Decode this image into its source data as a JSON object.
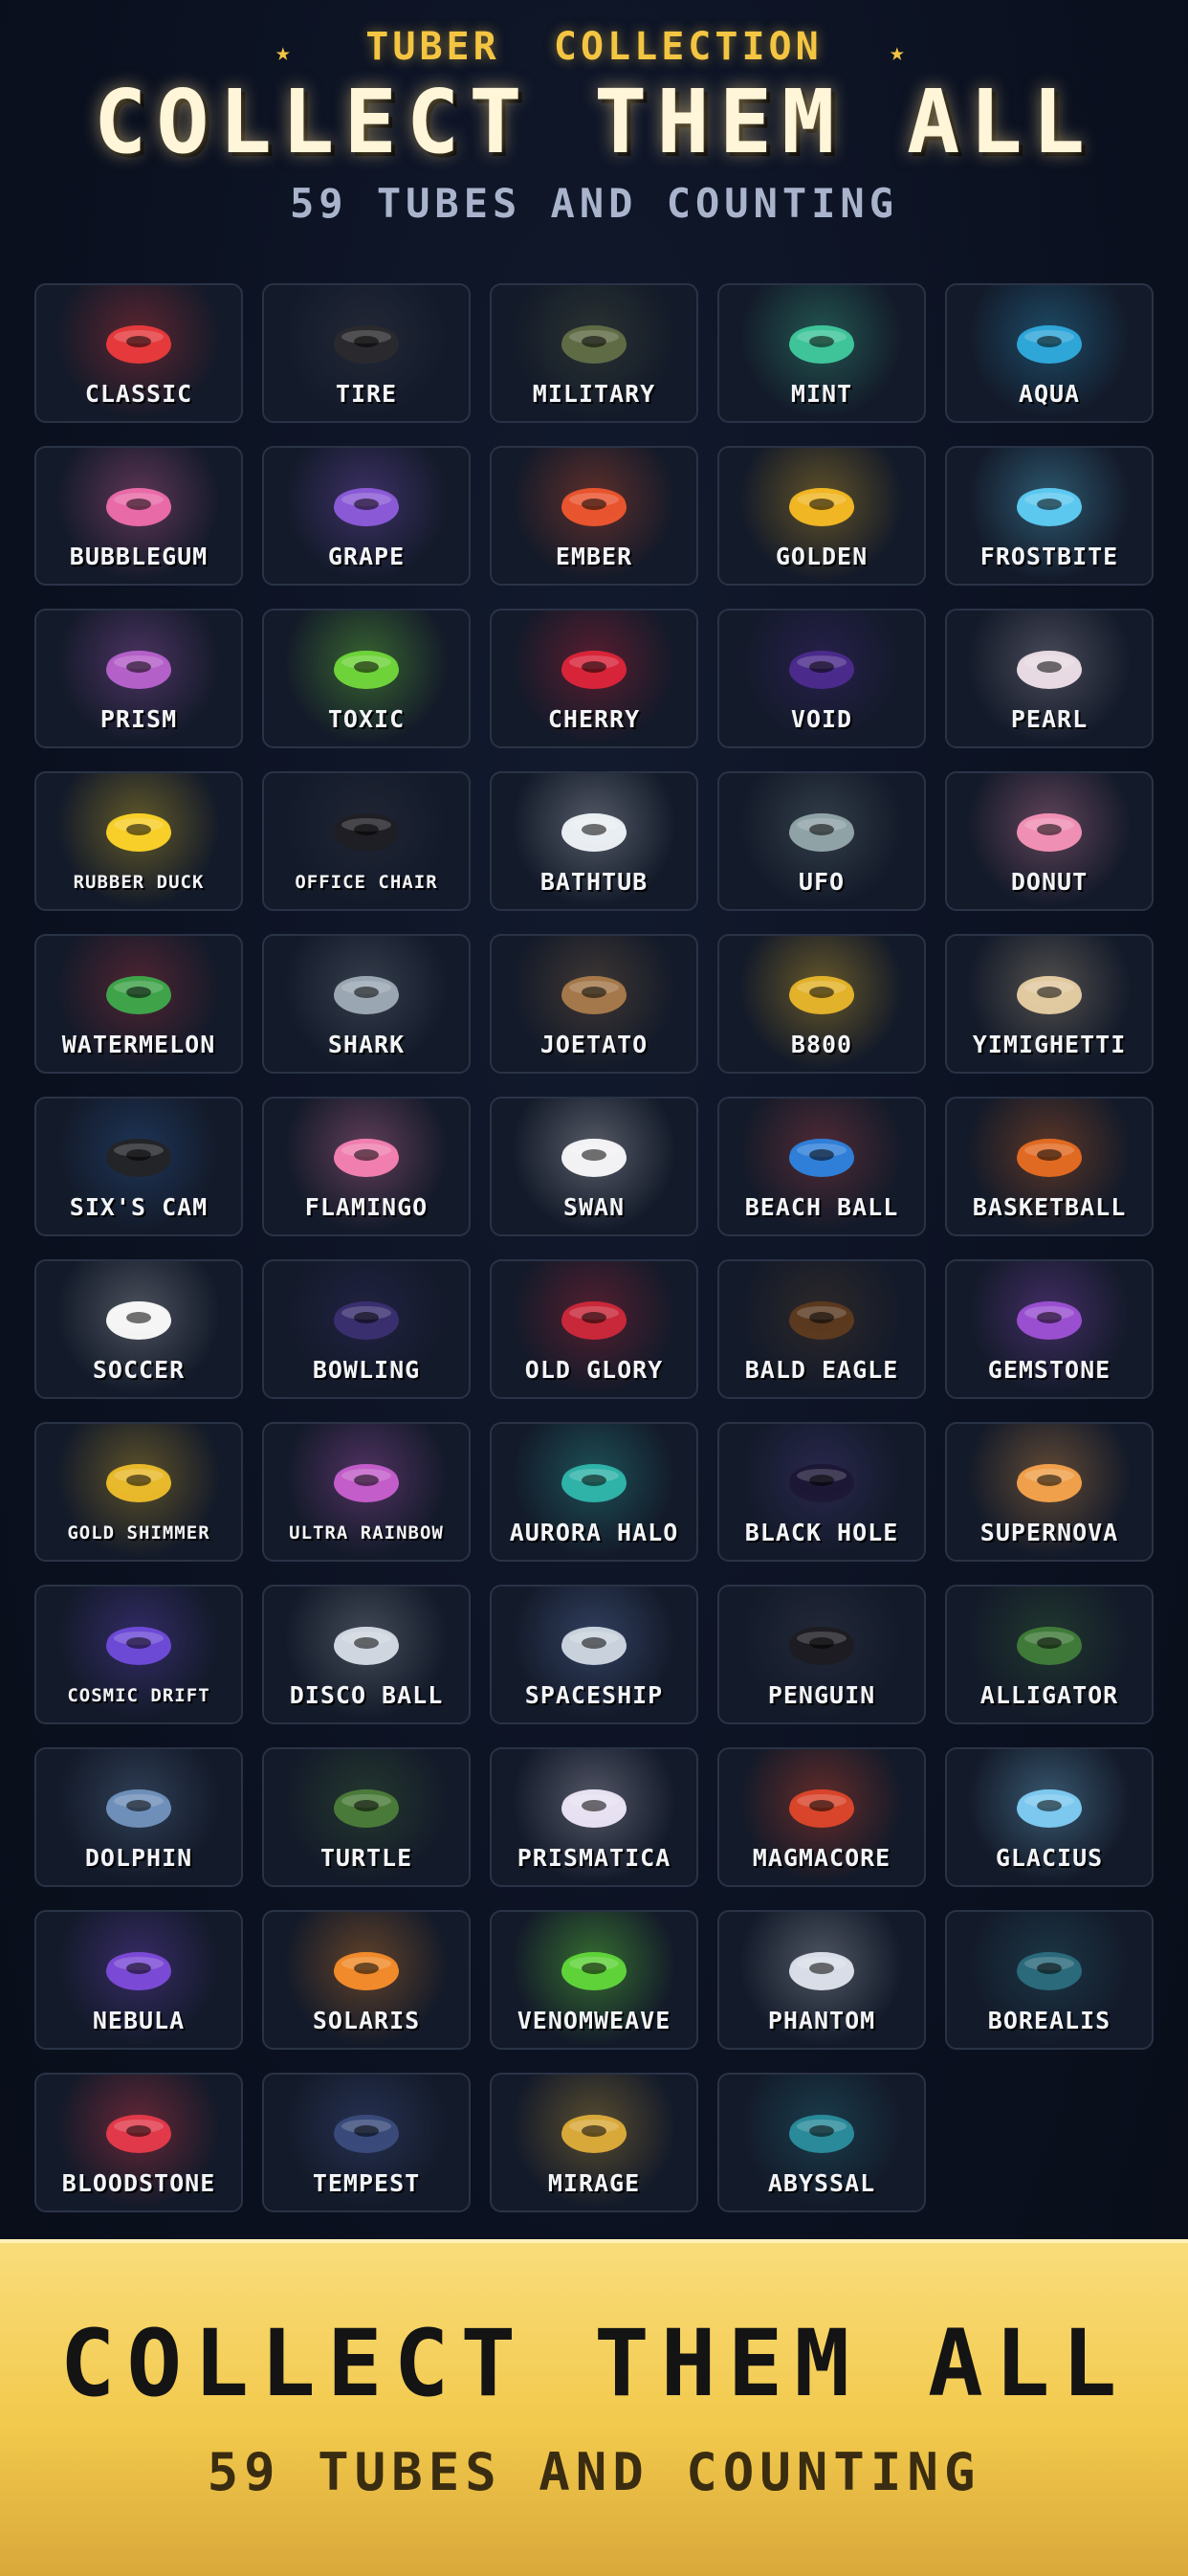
{
  "header": {
    "eyebrow": "TUBER  COLLECTION",
    "title": "COLLECT THEM ALL",
    "subtitle": "59 TUBES AND COUNTING"
  },
  "tubes": [
    {
      "name": "CLASSIC",
      "color": "#e5393c",
      "glow": "rgba(229,57,60,0.35)",
      "icon": "ring-icon"
    },
    {
      "name": "TIRE",
      "color": "#2a2a2e",
      "glow": "rgba(120,120,130,0.15)",
      "icon": "ring-icon"
    },
    {
      "name": "MILITARY",
      "color": "#5f6b45",
      "glow": "rgba(95,107,69,0.3)",
      "icon": "ring-icon"
    },
    {
      "name": "MINT",
      "color": "#3fc49a",
      "glow": "rgba(63,196,154,0.35)",
      "icon": "ring-icon"
    },
    {
      "name": "AQUA",
      "color": "#2fa6d8",
      "glow": "rgba(47,166,216,0.35)",
      "icon": "ring-icon"
    },
    {
      "name": "BUBBLEGUM",
      "color": "#e86aa7",
      "glow": "rgba(232,106,167,0.35)",
      "icon": "ring-icon"
    },
    {
      "name": "GRAPE",
      "color": "#8a5ad6",
      "glow": "rgba(138,90,214,0.35)",
      "icon": "ring-icon"
    },
    {
      "name": "EMBER",
      "color": "#e8552e",
      "glow": "rgba(232,85,46,0.35)",
      "icon": "ring-icon"
    },
    {
      "name": "GOLDEN",
      "color": "#f0b623",
      "glow": "rgba(240,182,35,0.35)",
      "icon": "ring-icon"
    },
    {
      "name": "FROSTBITE",
      "color": "#5cc8ee",
      "glow": "rgba(92,200,238,0.35)",
      "icon": "ring-icon"
    },
    {
      "name": "PRISM",
      "color": "#b460c9",
      "glow": "rgba(180,96,201,0.35)",
      "icon": "ring-icon"
    },
    {
      "name": "TOXIC",
      "color": "#6fd23a",
      "glow": "rgba(111,210,58,0.4)",
      "icon": "ring-icon"
    },
    {
      "name": "CHERRY",
      "color": "#d8243a",
      "glow": "rgba(216,36,58,0.35)",
      "icon": "ring-icon"
    },
    {
      "name": "VOID",
      "color": "#4a2a8a",
      "glow": "rgba(74,42,138,0.35)",
      "icon": "ring-icon"
    },
    {
      "name": "PEARL",
      "color": "#e8d9e2",
      "glow": "rgba(232,217,226,0.25)",
      "icon": "ring-icon"
    },
    {
      "name": "RUBBER DUCK",
      "color": "#f7cf28",
      "glow": "rgba(247,207,40,0.35)",
      "icon": "duck-icon",
      "small": true
    },
    {
      "name": "OFFICE CHAIR",
      "color": "#1e1f24",
      "glow": "rgba(100,100,110,0.15)",
      "icon": "chair-icon",
      "small": true
    },
    {
      "name": "BATHTUB",
      "color": "#e9edf2",
      "glow": "rgba(233,237,242,0.3)",
      "icon": "bathtub-icon"
    },
    {
      "name": "UFO",
      "color": "#8fa2a6",
      "glow": "rgba(143,162,166,0.25)",
      "icon": "ufo-icon"
    },
    {
      "name": "DONUT",
      "color": "#f08fb4",
      "glow": "rgba(240,143,180,0.35)",
      "icon": "donut-icon"
    },
    {
      "name": "WATERMELON",
      "color": "#3fa34a",
      "glow": "rgba(220,60,70,0.3)",
      "icon": "watermelon-icon"
    },
    {
      "name": "SHARK",
      "color": "#9aa7b3",
      "glow": "rgba(154,167,179,0.25)",
      "icon": "shark-icon"
    },
    {
      "name": "JOETATO",
      "color": "#a4784a",
      "glow": "rgba(164,120,74,0.3)",
      "icon": "potato-icon"
    },
    {
      "name": "B800",
      "color": "#e2b22a",
      "glow": "rgba(226,178,42,0.4)",
      "icon": "star-badge-icon"
    },
    {
      "name": "YIMIGHETTI",
      "color": "#e0c9a0",
      "glow": "rgba(224,201,160,0.3)",
      "icon": "noodle-bowl-icon"
    },
    {
      "name": "SIX'S CAM",
      "color": "#222428",
      "glow": "rgba(60,130,220,0.25)",
      "icon": "camera-icon"
    },
    {
      "name": "FLAMINGO",
      "color": "#f07fb0",
      "glow": "rgba(240,127,176,0.35)",
      "icon": "flamingo-icon"
    },
    {
      "name": "SWAN",
      "color": "#f2f2f4",
      "glow": "rgba(242,242,244,0.3)",
      "icon": "swan-icon"
    },
    {
      "name": "BEACH BALL",
      "color": "#2f7fd8",
      "glow": "rgba(220,80,80,0.3)",
      "icon": "beach-ball-icon"
    },
    {
      "name": "BASKETBALL",
      "color": "#e06a22",
      "glow": "rgba(224,106,34,0.35)",
      "icon": "basketball-icon"
    },
    {
      "name": "SOCCER",
      "color": "#f4f4f4",
      "glow": "rgba(244,244,244,0.25)",
      "icon": "soccer-ball-icon"
    },
    {
      "name": "BOWLING",
      "color": "#3a2f6e",
      "glow": "rgba(58,47,110,0.35)",
      "icon": "bowling-ball-icon"
    },
    {
      "name": "OLD GLORY",
      "color": "#c8283a",
      "glow": "rgba(200,40,58,0.35)",
      "icon": "flag-ring-icon"
    },
    {
      "name": "BALD EAGLE",
      "color": "#5b3a20",
      "glow": "rgba(120,80,40,0.25)",
      "icon": "eagle-icon"
    },
    {
      "name": "GEMSTONE",
      "color": "#9a4fd0",
      "glow": "rgba(154,79,208,0.35)",
      "icon": "gem-ring-icon"
    },
    {
      "name": "GOLD SHIMMER",
      "color": "#e8b82a",
      "glow": "rgba(232,184,42,0.35)",
      "icon": "ring-icon",
      "small": true
    },
    {
      "name": "ULTRA RAINBOW",
      "color": "#c25dc9",
      "glow": "rgba(194,93,201,0.35)",
      "icon": "ring-icon",
      "small": true
    },
    {
      "name": "AURORA HALO",
      "color": "#2fb2a8",
      "glow": "rgba(47,178,168,0.35)",
      "icon": "ring-icon"
    },
    {
      "name": "BLACK HOLE",
      "color": "#1d1836",
      "glow": "rgba(90,70,160,0.3)",
      "icon": "ring-icon"
    },
    {
      "name": "SUPERNOVA",
      "color": "#f0a04a",
      "glow": "rgba(240,160,74,0.35)",
      "icon": "ring-icon"
    },
    {
      "name": "COSMIC DRIFT",
      "color": "#6d4ad6",
      "glow": "rgba(109,74,214,0.35)",
      "icon": "ring-icon",
      "small": true
    },
    {
      "name": "DISCO BALL",
      "color": "#cfd6df",
      "glow": "rgba(207,214,223,0.25)",
      "icon": "disco-ball-icon"
    },
    {
      "name": "SPACESHIP",
      "color": "#c9d2dc",
      "glow": "rgba(120,150,220,0.3)",
      "icon": "rocket-icon"
    },
    {
      "name": "PENGUIN",
      "color": "#1c1c22",
      "glow": "rgba(120,120,140,0.15)",
      "icon": "penguin-icon"
    },
    {
      "name": "ALLIGATOR",
      "color": "#3f7a3a",
      "glow": "rgba(63,122,58,0.3)",
      "icon": "alligator-icon"
    },
    {
      "name": "DOLPHIN",
      "color": "#6f8fb8",
      "glow": "rgba(111,143,184,0.3)",
      "icon": "dolphin-icon"
    },
    {
      "name": "TURTLE",
      "color": "#4a7a3a",
      "glow": "rgba(74,122,58,0.3)",
      "icon": "turtle-icon"
    },
    {
      "name": "PRISMATICA",
      "color": "#e6e0f2",
      "glow": "rgba(230,224,242,0.3)",
      "icon": "ring-icon"
    },
    {
      "name": "MAGMACORE",
      "color": "#d8452a",
      "glow": "rgba(216,69,42,0.4)",
      "icon": "magma-ring-icon"
    },
    {
      "name": "GLACIUS",
      "color": "#7cc8ee",
      "glow": "rgba(124,200,238,0.35)",
      "icon": "ice-crown-icon"
    },
    {
      "name": "NEBULA",
      "color": "#7a4ad6",
      "glow": "rgba(122,74,214,0.35)",
      "icon": "nebula-icon"
    },
    {
      "name": "SOLARIS",
      "color": "#f08a2a",
      "glow": "rgba(240,138,42,0.35)",
      "icon": "sun-ring-icon"
    },
    {
      "name": "VENOMWEAVE",
      "color": "#5fd23a",
      "glow": "rgba(95,210,58,0.45)",
      "icon": "venom-ring-icon"
    },
    {
      "name": "PHANTOM",
      "color": "#d8dde6",
      "glow": "rgba(216,221,230,0.3)",
      "icon": "ghost-icon"
    },
    {
      "name": "BOREALIS",
      "color": "#2a6a7a",
      "glow": "rgba(42,106,122,0.35)",
      "icon": "aurora-ring-icon"
    },
    {
      "name": "BLOODSTONE",
      "color": "#e03a4a",
      "glow": "rgba(224,58,74,0.4)",
      "icon": "gem-icon"
    },
    {
      "name": "TEMPEST",
      "color": "#3a4a7a",
      "glow": "rgba(80,100,170,0.3)",
      "icon": "storm-cloud-icon"
    },
    {
      "name": "MIRAGE",
      "color": "#d8a83a",
      "glow": "rgba(216,168,58,0.35)",
      "icon": "gear-ring-icon"
    },
    {
      "name": "ABYSSAL",
      "color": "#2a8a9a",
      "glow": "rgba(42,138,154,0.3)",
      "icon": "orb-ring-icon"
    }
  ],
  "banner": {
    "title": "COLLECT THEM ALL",
    "subtitle": "59 TUBES AND COUNTING"
  }
}
